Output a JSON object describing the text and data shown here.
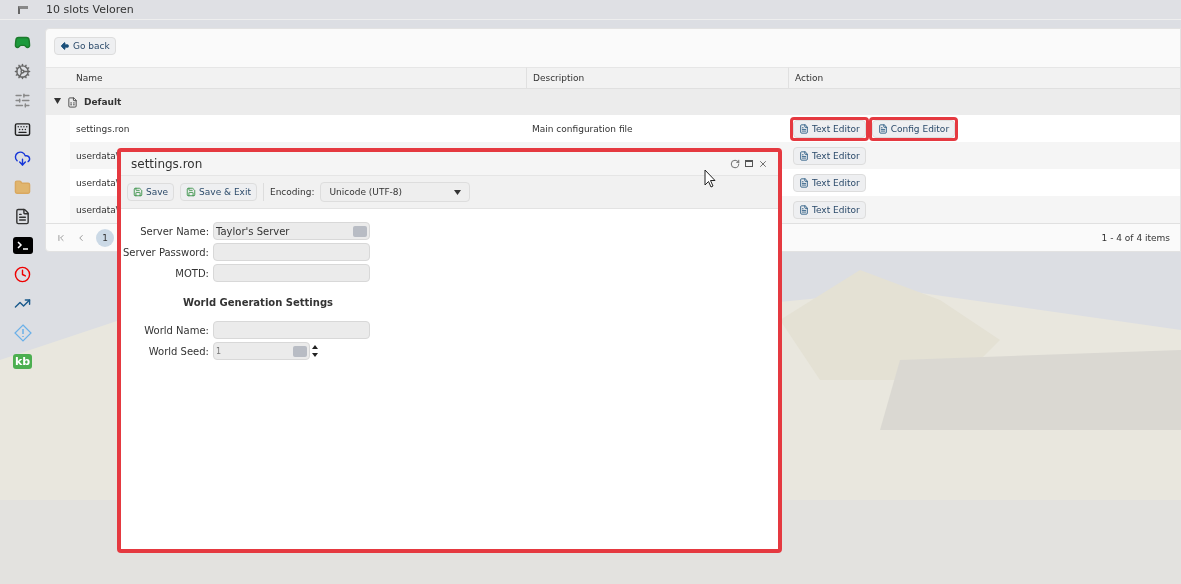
{
  "window": {
    "title": "10 slots Veloren"
  },
  "sidebar": {
    "badge_text": "kb"
  },
  "toolbar": {
    "back_button": "Go back"
  },
  "table": {
    "columns": [
      "Name",
      "Description",
      "Action"
    ],
    "group": {
      "label": "Default",
      "expanded": true
    },
    "rows": [
      {
        "name": "settings.ron",
        "description": "Main configuration file",
        "actions": [
          {
            "label": "Text Editor",
            "highlighted": true
          },
          {
            "label": "Config Editor",
            "highlighted": true
          }
        ]
      },
      {
        "name": "userdata\\",
        "actions": [
          {
            "label": "Text Editor",
            "highlighted": false
          }
        ]
      },
      {
        "name": "userdata\\",
        "actions": [
          {
            "label": "Text Editor",
            "highlighted": false
          }
        ]
      },
      {
        "name": "userdata\\",
        "actions": [
          {
            "label": "Text Editor",
            "highlighted": false
          }
        ]
      }
    ],
    "pager": {
      "pages": [
        {
          "label": "1",
          "selected": true
        }
      ],
      "summary": "1 - 4 of 4 items"
    }
  },
  "dialog": {
    "title": "settings.ron",
    "highlighted": true,
    "toolbar": {
      "save": "Save",
      "save_exit": "Save & Exit",
      "encoding_label": "Encoding:",
      "encoding_value": "Unicode (UTF-8)"
    },
    "fields": [
      {
        "kind": "text",
        "label": "Server Name:",
        "value": "Taylor's Server",
        "has_picker": true
      },
      {
        "kind": "text",
        "label": "Server Password:",
        "has_picker": false
      },
      {
        "kind": "text",
        "label": "MOTD:",
        "has_picker": false
      },
      {
        "kind": "heading",
        "label": "World Generation Settings"
      },
      {
        "kind": "text",
        "label": "World Name:",
        "has_picker": false
      },
      {
        "kind": "numeric",
        "label": "World Seed:",
        "value": "1",
        "has_picker": true
      }
    ]
  }
}
